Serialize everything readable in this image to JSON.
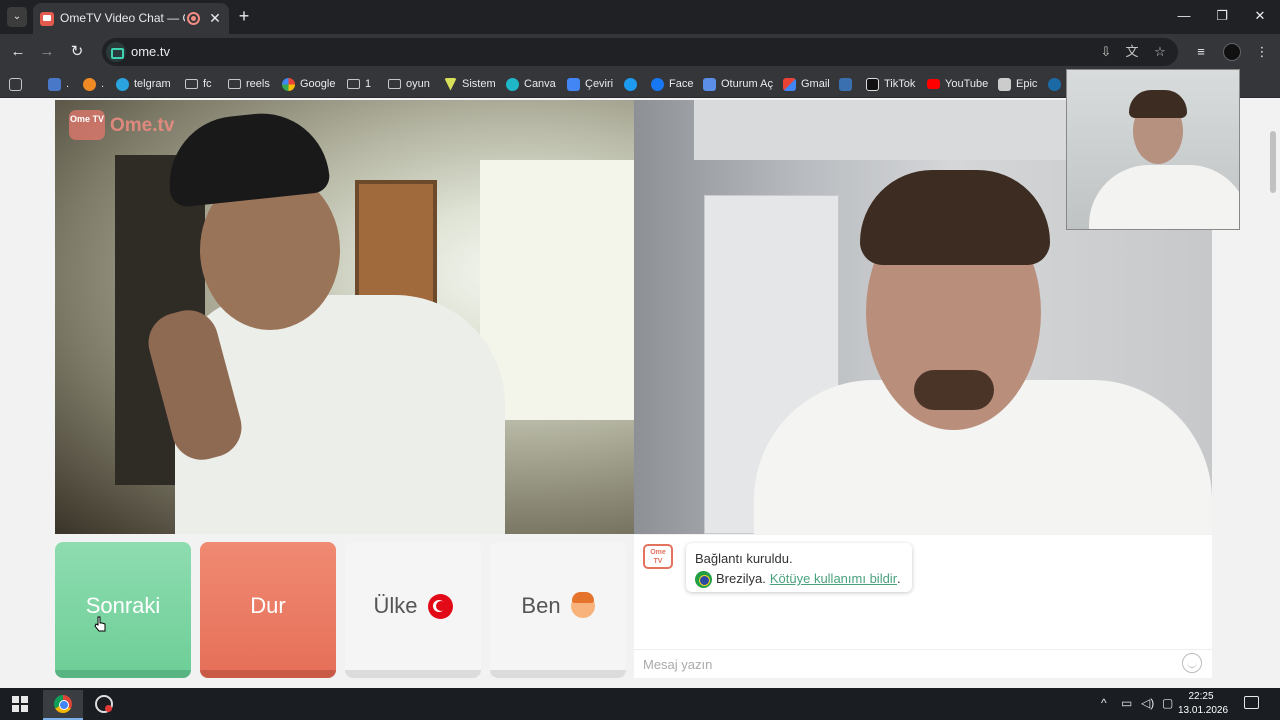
{
  "browser": {
    "tab_title": "OmeTV Video Chat — Ome",
    "tab_close": "✕",
    "new_tab": "+",
    "url": "ome.tv",
    "window_minimize": "—",
    "window_maximize": "❐",
    "window_close": "✕"
  },
  "bookmarks": [
    {
      "label": "telgram",
      "icon": "telegram-icon",
      "color": "#2aa3df"
    },
    {
      "label": "fc",
      "icon": "folder-icon"
    },
    {
      "label": "reels",
      "icon": "folder-icon"
    },
    {
      "label": "Google",
      "icon": "google-icon",
      "color": "#ea4335"
    },
    {
      "label": "1",
      "icon": "folder-icon"
    },
    {
      "label": "oyun",
      "icon": "folder-icon"
    },
    {
      "label": "Sistem",
      "icon": "v-icon",
      "color": "#d8e05a"
    },
    {
      "label": "Canva",
      "icon": "canva-icon",
      "color": "#1fb6c7"
    },
    {
      "label": "Çeviri",
      "icon": "translate-icon",
      "color": "#4285f4"
    },
    {
      "label": "Face",
      "icon": "facebook-icon",
      "color": "#1877f2"
    },
    {
      "label": "Oturum Aç",
      "icon": "login-icon",
      "color": "#5b8ee6"
    },
    {
      "label": "Gmail",
      "icon": "gmail-icon",
      "color": "#ea4335"
    },
    {
      "label": "TikTok",
      "icon": "tiktok-icon",
      "color": "#ffffff"
    },
    {
      "label": "YouTube",
      "icon": "youtube-icon",
      "color": "#ff0000"
    },
    {
      "label": "Epic",
      "icon": "epic-icon",
      "color": "#cccccc"
    }
  ],
  "video": {
    "logo_badge": "Ome TV",
    "logo_text": "Ome.tv"
  },
  "buttons": {
    "next": "Sonraki",
    "stop": "Dur",
    "country": "Ülke",
    "me": "Ben"
  },
  "chat": {
    "logo": "Ome TV",
    "connected": "Bağlantı kuruldu.",
    "country": "Brezilya.",
    "report": "Kötüye kullanımı bildir",
    "report_suffix": ".",
    "input_placeholder": "Mesaj yazın"
  },
  "taskbar": {
    "time": "22:25",
    "date": "13.01.2026"
  },
  "colors": {
    "next_green": "#6fcf98",
    "stop_red": "#e6705a",
    "link_green": "#4aa27c"
  }
}
